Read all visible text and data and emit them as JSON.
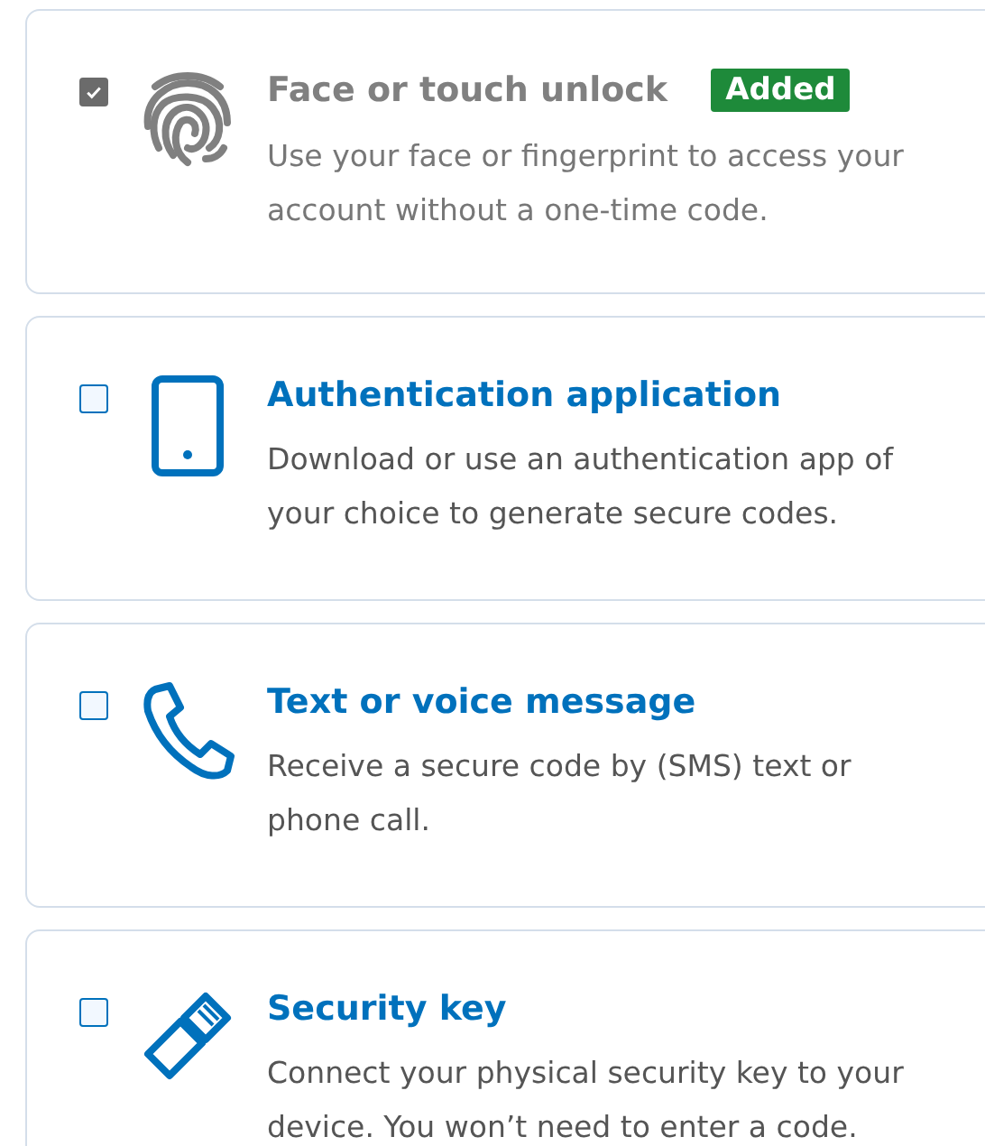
{
  "methods": [
    {
      "kind": "fingerprint",
      "title": "Face or touch unlock",
      "badge": "Added",
      "description": "Use your face or fingerprint to access your account without a one-time code.",
      "checked": true,
      "disabled": true
    },
    {
      "kind": "tablet",
      "title": "Authentication application",
      "description": "Download or use an authentication app of your choice to generate secure codes.",
      "checked": false,
      "disabled": false
    },
    {
      "kind": "phone",
      "title": "Text or voice message",
      "description": "Receive a secure code by (SMS) text or phone call.",
      "checked": false,
      "disabled": false
    },
    {
      "kind": "key",
      "title": "Security key",
      "description": "Connect your physical security key to your device. You won’t need to enter a code.",
      "checked": false,
      "disabled": false
    }
  ]
}
